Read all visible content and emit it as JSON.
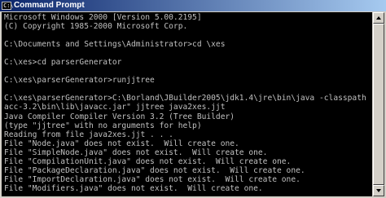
{
  "window": {
    "title": "Command Prompt",
    "icon_text": "C:\\"
  },
  "console": {
    "lines": [
      "Microsoft Windows 2000 [Version 5.00.2195]",
      "(C) Copyright 1985-2000 Microsoft Corp.",
      "",
      "C:\\Documents and Settings\\Administrator>cd \\xes",
      "",
      "C:\\xes>cd parserGenerator",
      "",
      "C:\\xes\\parserGenerator>runjjtree",
      "",
      "C:\\xes\\parserGenerator>C:\\Borland\\JBuilder2005\\jdk1.4\\jre\\bin\\java -classpath \"j",
      "acc-3.2\\bin\\lib\\javacc.jar\" jjtree java2xes.jjt",
      "Java Compiler Compiler Version 3.2 (Tree Builder)",
      "(type \"jjtree\" with no arguments for help)",
      "Reading from file java2xes.jjt . . .",
      "File \"Node.java\" does not exist.  Will create one.",
      "File \"SimpleNode.java\" does not exist.  Will create one.",
      "File \"CompilationUnit.java\" does not exist.  Will create one.",
      "File \"PackageDeclaration.java\" does not exist.  Will create one.",
      "File \"ImportDeclaration.java\" does not exist.  Will create one.",
      "File \"Modifiers.java\" does not exist.  Will create one."
    ]
  },
  "scrollbar": {
    "position_fraction": 0.0
  }
}
